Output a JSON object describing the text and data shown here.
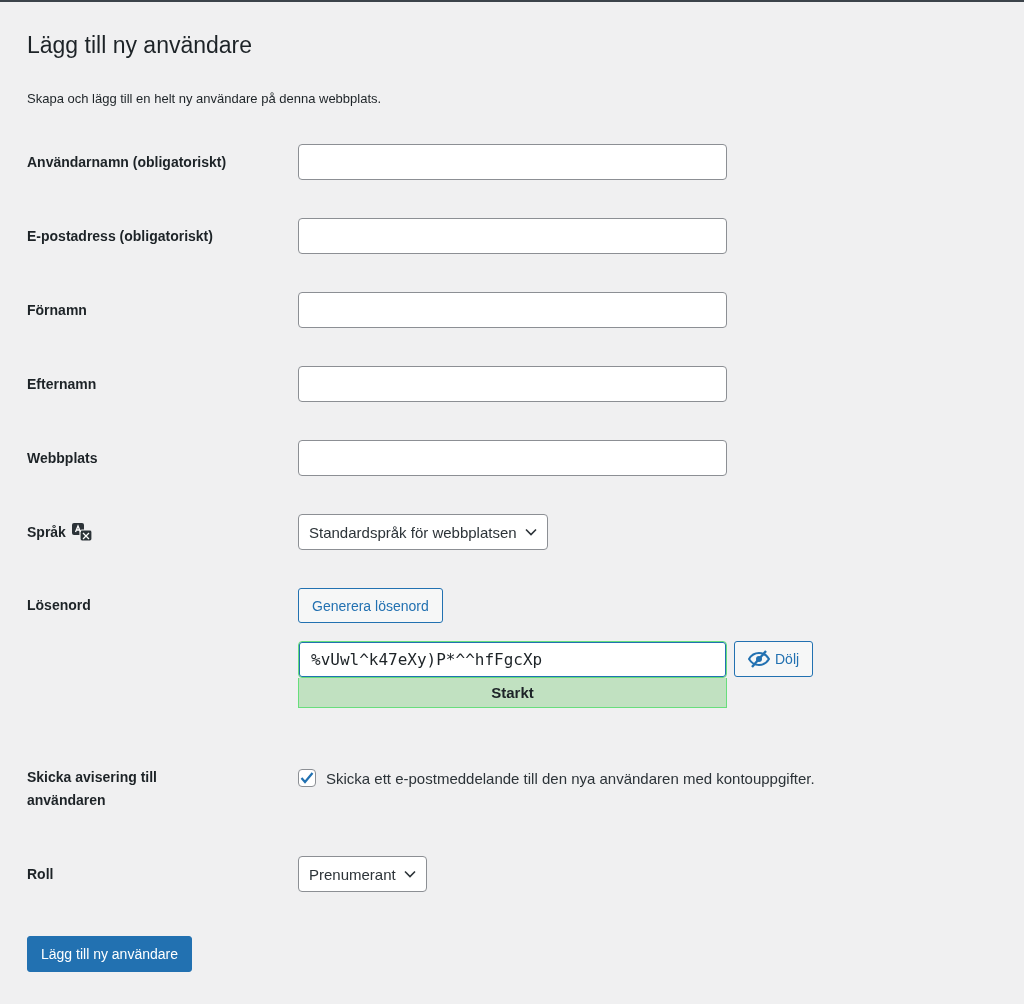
{
  "page": {
    "title": "Lägg till ny användare",
    "description": "Skapa och lägg till en helt ny användare på denna webbplats."
  },
  "fields": [
    {
      "kind": "text",
      "label": "Användarnamn (obligatoriskt)"
    },
    {
      "kind": "text",
      "label": "E-postadress (obligatoriskt)"
    },
    {
      "kind": "text",
      "label": "Förnamn"
    },
    {
      "kind": "text",
      "label": "Efternamn"
    },
    {
      "kind": "text",
      "label": "Webbplats"
    },
    {
      "kind": "language",
      "label": "Språk",
      "value": "Standardspråk för webbplatsen"
    },
    {
      "kind": "password",
      "label": "Lösenord",
      "generate": "Generera lösenord",
      "value": "%vUwl^k47eXy)P*^^hfFgcXp",
      "toggle": "Dölj",
      "strength": "Starkt"
    },
    {
      "kind": "checkbox",
      "label": "Skicka avisering till användaren",
      "text": "Skicka ett e-postmeddelande till den nya användaren med kontouppgifter.",
      "checked": true
    },
    {
      "kind": "select",
      "label": "Roll",
      "value": "Prenumerant"
    }
  ],
  "submit": "Lägg till ny användare"
}
